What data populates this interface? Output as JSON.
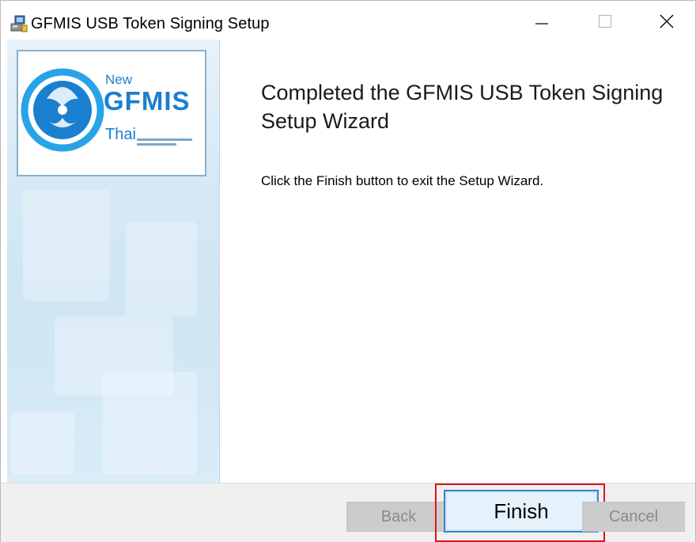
{
  "window": {
    "title": "GFMIS USB Token Signing Setup",
    "controls": {
      "minimize": "minimize",
      "maximize": "maximize",
      "close": "close"
    }
  },
  "logo": {
    "line1": "New",
    "line2": "GFMIS",
    "line3": "Thai"
  },
  "main": {
    "heading_line1": "Completed the GFMIS USB Token Signing",
    "heading_line2": "Setup Wizard",
    "description": "Click the Finish button to exit the Setup Wizard."
  },
  "buttons": {
    "back": "Back",
    "finish": "Finish",
    "cancel": "Cancel"
  },
  "colors": {
    "accent": "#3c82c4",
    "highlight": "#e0141d",
    "logo_blue": "#1b7fd0"
  }
}
